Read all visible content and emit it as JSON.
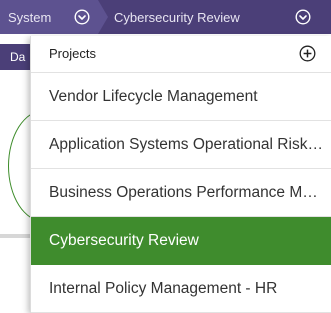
{
  "breadcrumb": {
    "system_label": "System",
    "current_label": "Cybersecurity Review"
  },
  "background": {
    "tab_label": "Da"
  },
  "projects_menu": {
    "header": "Projects",
    "items": [
      {
        "label": "Vendor Lifecycle Management",
        "selected": false
      },
      {
        "label": "Application Systems Operational Risk Management",
        "selected": false
      },
      {
        "label": "Business Operations Performance Management",
        "selected": false
      },
      {
        "label": "Cybersecurity Review",
        "selected": true
      },
      {
        "label": "Internal Policy Management - HR",
        "selected": false
      }
    ]
  },
  "colors": {
    "topbar": "#4b3f78",
    "selected": "#3f8c2d",
    "accent_green": "#3d8c2a"
  },
  "icons": [
    "chevron-down-circle-icon",
    "plus-circle-icon"
  ]
}
